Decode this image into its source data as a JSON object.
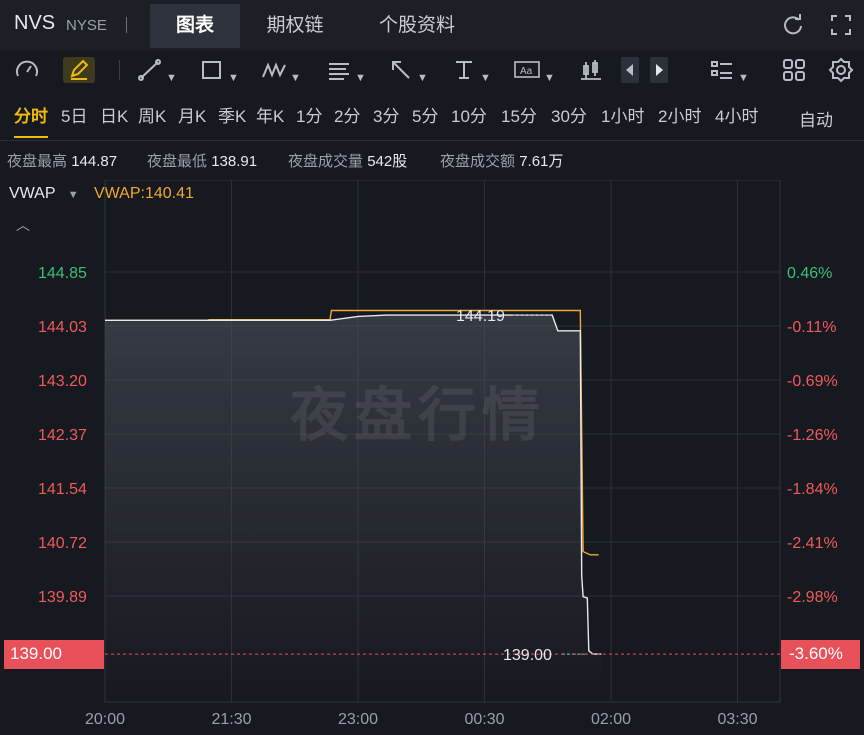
{
  "header": {
    "symbol": "NVS",
    "exchange": "NYSE",
    "tabs": [
      "图表",
      "期权链",
      "个股资料"
    ],
    "active_tab": 0,
    "icons": [
      "refresh-icon",
      "expand-icon"
    ]
  },
  "toolbar": {
    "icons": [
      "gauge-icon",
      "pen-icon",
      "line-icon",
      "rectangle-icon",
      "wave-icon",
      "parallel-lines-icon",
      "arrow-icon",
      "text-cursor-icon",
      "text-box-icon",
      "candle-icon",
      "prev-icon",
      "next-icon",
      "layout-icon",
      "grid-icon",
      "settings-icon"
    ]
  },
  "periods": {
    "items": [
      "分时",
      "5日",
      "日K",
      "周K",
      "月K",
      "季K",
      "年K",
      "1分",
      "2分",
      "3分",
      "5分",
      "10分",
      "15分",
      "30分",
      "1小时",
      "2小时",
      "4小时"
    ],
    "active": 0,
    "auto_label": "自动"
  },
  "stats": [
    {
      "label": "夜盘最高",
      "value": "144.87"
    },
    {
      "label": "夜盘最低",
      "value": "138.91"
    },
    {
      "label": "夜盘成交量",
      "value": "542股"
    },
    {
      "label": "夜盘成交额",
      "value": "7.61万"
    }
  ],
  "indicator": {
    "name": "VWAP",
    "value_label": "VWAP:140.41"
  },
  "watermark": "夜盘行情",
  "colors": {
    "up": "#3dbf7a",
    "down": "#f05a5a",
    "vwap": "#f0a830",
    "price": "#e6e8ec",
    "current_price_bg": "#e8505a"
  },
  "chart_data": {
    "type": "line",
    "x_ticks": [
      "20:00",
      "21:30",
      "23:00",
      "00:30",
      "02:00",
      "03:30"
    ],
    "y_ticks_left": [
      "144.85",
      "144.03",
      "143.20",
      "142.37",
      "141.54",
      "140.72",
      "139.89"
    ],
    "y_ticks_right": [
      "0.46%",
      "-0.11%",
      "-0.69%",
      "-1.26%",
      "-1.84%",
      "-2.41%",
      "-2.98%"
    ],
    "ylim": [
      138.6,
      145.65
    ],
    "xlim_minutes": [
      0,
      480
    ],
    "current_price_label": "139.00",
    "current_change_label": "-3.60%",
    "high_marker_label": "144.19",
    "low_marker_label": "139.00",
    "series": [
      {
        "name": "price",
        "points": [
          [
            0,
            144.11
          ],
          [
            40,
            144.11
          ],
          [
            80,
            144.11
          ],
          [
            120,
            144.11
          ],
          [
            160,
            144.11
          ],
          [
            180,
            144.17
          ],
          [
            200,
            144.19
          ],
          [
            250,
            144.19
          ],
          [
            318,
            144.19
          ],
          [
            322,
            143.95
          ],
          [
            335,
            143.95
          ],
          [
            338,
            143.95
          ],
          [
            339,
            140.2
          ],
          [
            340,
            139.88
          ],
          [
            343,
            139.86
          ],
          [
            344,
            139.05
          ],
          [
            347,
            139.0
          ],
          [
            353,
            139.0
          ]
        ]
      },
      {
        "name": "VWAP",
        "points": [
          [
            0,
            144.11
          ],
          [
            73,
            144.11
          ],
          [
            74,
            144.12
          ],
          [
            160,
            144.12
          ],
          [
            161,
            144.26
          ],
          [
            338,
            144.26
          ],
          [
            340,
            140.57
          ],
          [
            345,
            140.52
          ],
          [
            351,
            140.52
          ]
        ]
      }
    ]
  }
}
